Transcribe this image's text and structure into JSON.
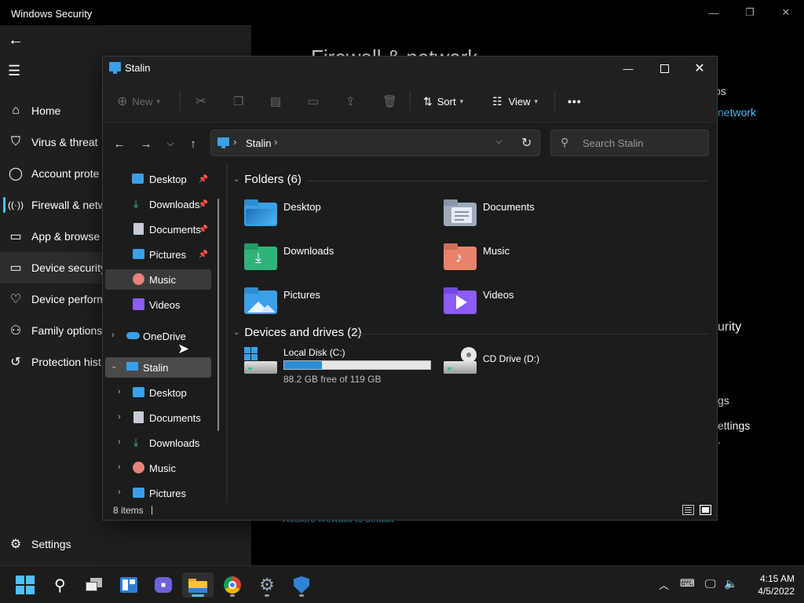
{
  "security": {
    "title": "Windows Security",
    "nav": [
      {
        "label": "Home",
        "icon": "⌂"
      },
      {
        "label": "Virus & threat",
        "icon": "⛉"
      },
      {
        "label": "Account prote",
        "icon": "👤"
      },
      {
        "label": "Firewall & netw",
        "icon": "((·))"
      },
      {
        "label": "App & browse",
        "icon": "▭"
      },
      {
        "label": "Device security",
        "icon": "▭"
      },
      {
        "label": "Device perform",
        "icon": "♡"
      },
      {
        "label": "Family options",
        "icon": "⚇"
      },
      {
        "label": "Protection hist",
        "icon": "↺"
      }
    ],
    "settings_label": "Settings",
    "main_heading_peek": "Firewall & network",
    "peek_ps": "ps",
    "peek_network": "network",
    "peek_urity": "urity",
    "peek_gs": "gs",
    "peek_ettings": "ettings",
    "peek_dot": ".",
    "peek_restore": "Restore firewalls to default"
  },
  "explorer": {
    "title": "Stalin",
    "toolbar": {
      "new_label": "New",
      "sort_label": "Sort",
      "view_label": "View",
      "more_label": "•••"
    },
    "address": {
      "path": "Stalin",
      "search_placeholder": "Search Stalin"
    },
    "nav": {
      "quick": [
        {
          "label": "Desktop",
          "pinned": true
        },
        {
          "label": "Downloads",
          "pinned": true
        },
        {
          "label": "Documents",
          "pinned": true
        },
        {
          "label": "Pictures",
          "pinned": true
        },
        {
          "label": "Music",
          "pinned": false
        },
        {
          "label": "Videos",
          "pinned": false
        }
      ],
      "onedrive": "OneDrive",
      "thispc": "Stalin",
      "thispc_children": [
        "Desktop",
        "Documents",
        "Downloads",
        "Music",
        "Pictures"
      ]
    },
    "content": {
      "folders_header": "Folders (6)",
      "folders": [
        "Desktop",
        "Documents",
        "Downloads",
        "Music",
        "Pictures",
        "Videos"
      ],
      "drives_header": "Devices and drives (2)",
      "drive_c": {
        "name": "Local Disk (C:)",
        "free_text": "88.2 GB free of 119 GB",
        "used_fraction": 0.26
      },
      "drive_d": {
        "name": "CD Drive (D:)"
      }
    },
    "status": {
      "items": "8 items"
    }
  },
  "taskbar": {
    "time": "4:15 AM",
    "date": "4/5/2022"
  },
  "colors": {
    "accent": "#4cc2ff",
    "folder_blue": "#3aa0e8",
    "disk_bar": "#2b8fd8"
  }
}
